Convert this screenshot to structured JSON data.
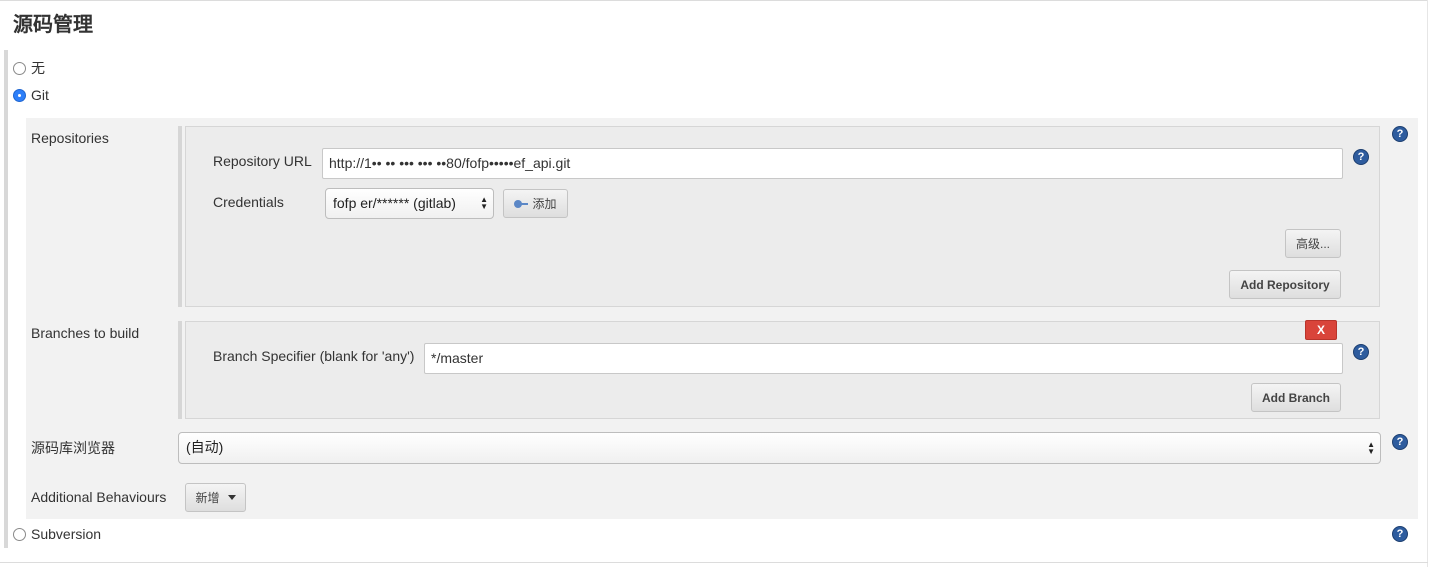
{
  "section": {
    "title": "源码管理"
  },
  "scm_options": {
    "none_label": "无",
    "git_label": "Git",
    "svn_label": "Subversion",
    "selected": "Git"
  },
  "repositories": {
    "label": "Repositories",
    "url_label": "Repository URL",
    "url_value": "http://1•• •• ••• ••• ••80/fofp•••••ef_api.git",
    "credentials_label": "Credentials",
    "credentials_value": "fofp   er/****** (gitlab)",
    "add_credentials_label": "添加",
    "advanced_label": "高级...",
    "add_repository_label": "Add Repository"
  },
  "branches": {
    "label": "Branches to build",
    "delete_label": "X",
    "specifier_label": "Branch Specifier (blank for 'any')",
    "specifier_value": "*/master",
    "add_branch_label": "Add Branch"
  },
  "browser": {
    "label": "源码库浏览器",
    "value": "(自动)"
  },
  "behaviours": {
    "label": "Additional Behaviours",
    "add_label": "新增"
  },
  "help": {
    "glyph": "?"
  },
  "select_arrows": "▲▼",
  "colors": {
    "radio_selected": "#2d7ff9",
    "help_icon": "#2e5c9e",
    "delete_button": "#d9443a"
  }
}
